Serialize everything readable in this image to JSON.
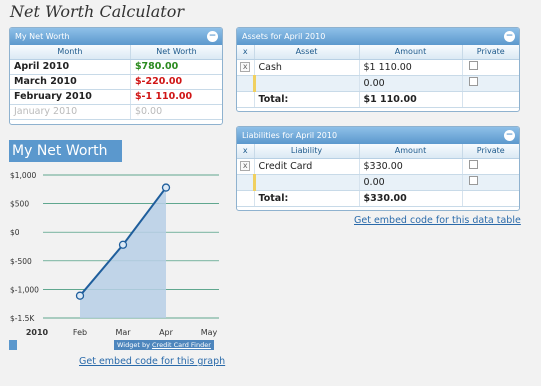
{
  "page": {
    "title": "Net Worth Calculator"
  },
  "networth_panel": {
    "title": "My Net Worth",
    "headers": [
      "Month",
      "Net Worth"
    ],
    "rows": [
      {
        "month": "April 2010",
        "value": "$780.00"
      },
      {
        "month": "March 2010",
        "value": "$-220.00"
      },
      {
        "month": "February 2010",
        "value": "$-1 110.00"
      },
      {
        "month": "January 2010",
        "value": "$0.00"
      }
    ]
  },
  "assets_panel": {
    "title": "Assets for April 2010",
    "headers": [
      "x",
      "Asset",
      "Amount",
      "Private"
    ],
    "row1": {
      "x": "x",
      "name": "Cash",
      "amount": "$1 110.00"
    },
    "row2": {
      "amount": "0.00"
    },
    "total_label": "Total:",
    "total_value": "$1 110.00"
  },
  "liabilities_panel": {
    "title": "Liabilities for April 2010",
    "headers": [
      "x",
      "Liability",
      "Amount",
      "Private"
    ],
    "row1": {
      "x": "x",
      "name": "Credit Card",
      "amount": "$330.00"
    },
    "row2": {
      "amount": "0.00"
    },
    "total_label": "Total:",
    "total_value": "$330.00"
  },
  "embed_table_link": "Get embed code for this data table",
  "embed_graph_link": "Get embed code for this graph",
  "widget_credit": {
    "prefix": "Widget by",
    "link": "Credit Card Finder"
  },
  "chart_data": {
    "type": "area",
    "title": "My Net Worth",
    "x": [
      "Feb",
      "Mar",
      "Apr"
    ],
    "values": [
      -1110,
      -220,
      780
    ],
    "xticks": [
      "2010",
      "Feb",
      "Mar",
      "Apr",
      "May"
    ],
    "yticks": [
      "$1,000",
      "$500",
      "$0",
      "$-500",
      "$-1,000",
      "$-1.5K"
    ],
    "ylim": [
      -1500,
      1000
    ],
    "grid": true,
    "color": "#1f5e9c"
  }
}
